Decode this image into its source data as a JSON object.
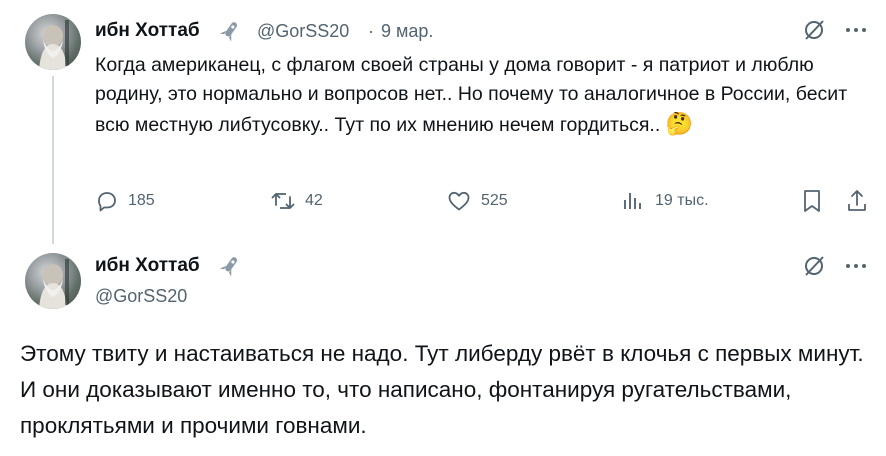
{
  "reply_tweet": {
    "display_name": "ибн Хоттаб",
    "handle": "@GorSS20",
    "separator": "·",
    "date": "9 мар.",
    "text": "Когда американец, с флагом своей страны у дома говорит - я патриот и люблю родину, это нормально и вопросов нет.. Но почему то аналогичное в России, бесит всю местную либтусовку.. Тут по их мнению нечем гордиться..",
    "emoji": "🤔",
    "actions": {
      "replies": "185",
      "reposts": "42",
      "likes": "525",
      "views": "19 тыс."
    }
  },
  "main_tweet": {
    "display_name": "ибн Хоттаб",
    "handle": "@GorSS20",
    "text": "Этому твиту и настаиваться не надо. Тут либерду рвёт в клочья с первых минут. И они доказывают именно то, что написано, фонтанируя ругательствами, проклятьями и прочими говнами."
  },
  "icons": {
    "badge": "rocket-badge-icon",
    "grok": "grok-slash-icon",
    "more": "more-dots-icon",
    "reply": "reply-bubble-icon",
    "repost": "repost-icon",
    "like": "heart-icon",
    "views": "views-bar-icon",
    "bookmark": "bookmark-icon",
    "share": "share-icon"
  },
  "colors": {
    "text": "#0f1419",
    "muted": "#536471",
    "thread_line": "#cfd9de"
  }
}
